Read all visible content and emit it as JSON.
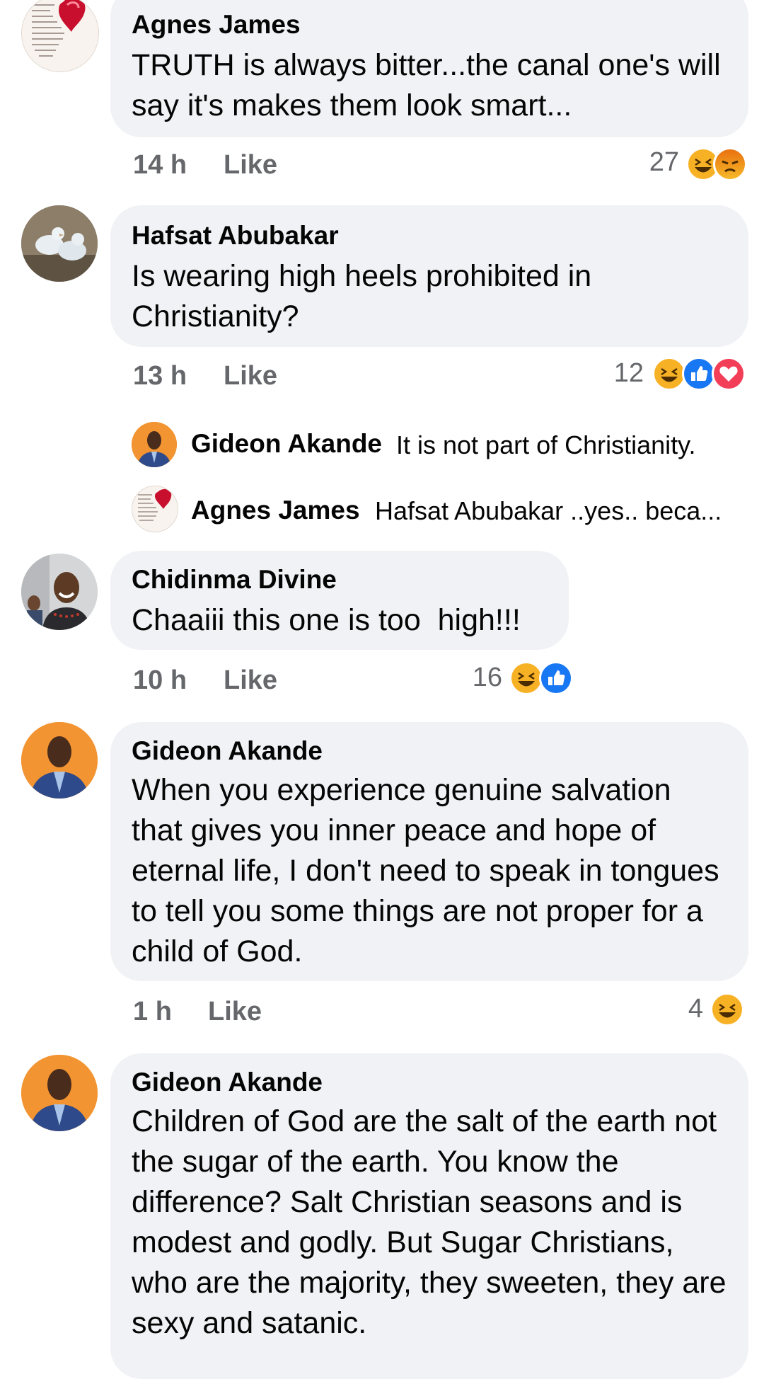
{
  "comments": [
    {
      "author": "Agnes James",
      "text": "TRUTH is always bitter...the canal one's will say it's makes them look smart...",
      "time": "14 h",
      "like_label": "Like",
      "reaction_count": "27",
      "reactions": [
        "haha",
        "angry"
      ]
    },
    {
      "author": "Hafsat Abubakar",
      "text": "Is wearing high heels prohibited in Christianity?",
      "time": "13 h",
      "like_label": "Like",
      "reaction_count": "12",
      "reactions": [
        "haha",
        "like",
        "love"
      ],
      "replies": [
        {
          "author": "Gideon Akande",
          "text": "It is not part of Christianity."
        },
        {
          "author": "Agnes James",
          "text": "Hafsat Abubakar ..yes.. beca..."
        }
      ]
    },
    {
      "author": "Chidinma Divine",
      "text": "Chaaiii this one is too  high!!!",
      "time": "10 h",
      "like_label": "Like",
      "reaction_count": "16",
      "reactions": [
        "haha",
        "like"
      ]
    },
    {
      "author": "Gideon Akande",
      "text": "When you experience genuine salvation that gives you inner peace and hope of eternal life, I don't need to speak in tongues to tell you some things are not proper for a child of God.",
      "time": "1 h",
      "like_label": "Like",
      "reaction_count": "4",
      "reactions": [
        "haha"
      ]
    },
    {
      "author": "Gideon Akande",
      "text": "Children of God are the salt of the earth not the sugar of the earth. You know the difference? Salt Christian seasons and is modest and godly. But Sugar Christians, who are the majority, they sweeten, they are sexy and satanic."
    }
  ],
  "colors": {
    "bubble": "#f0f2f5",
    "meta": "#65676b",
    "like_blue": "#1877f2",
    "love_red": "#f33e58",
    "haha_yellow": "#f7b125",
    "angry_orange": "#e9710f"
  }
}
